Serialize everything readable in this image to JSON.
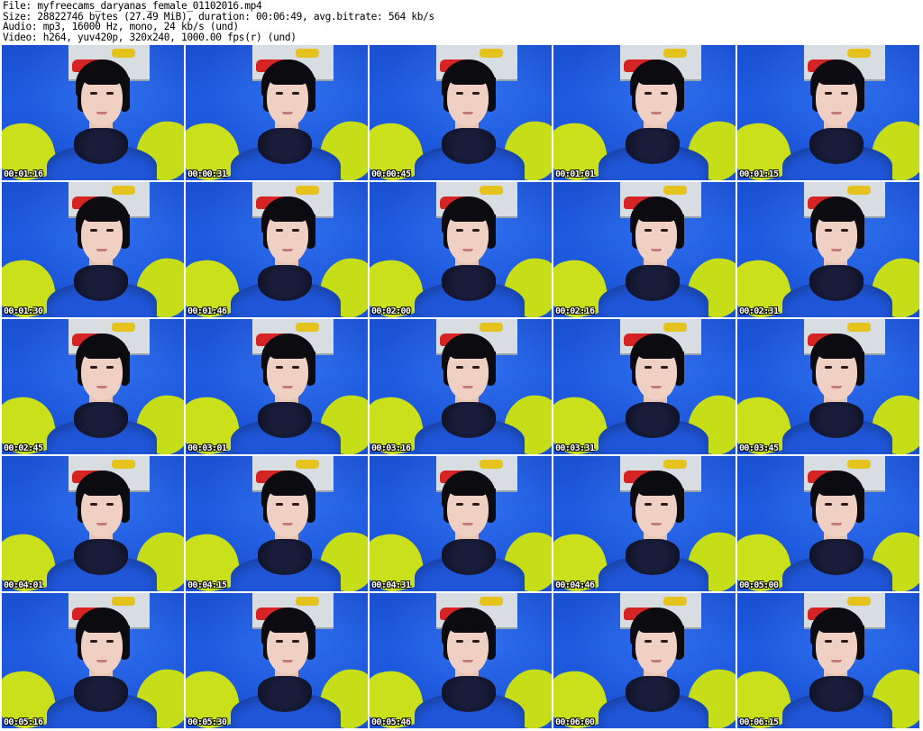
{
  "header": {
    "file_line": "File: myfreecams_daryanas_female_01102016.mp4",
    "size_line": "Size: 28822746 bytes (27.49 MiB), duration: 00:06:49, avg.bitrate: 564 kb/s",
    "audio_line": "Audio: mp3, 16000 Hz, mono, 24 kb/s (und)",
    "video_line": "Video: h264, yuv420p, 320x240, 1000.00 fps(r) (und)"
  },
  "thumbnails": [
    {
      "timestamp": "00:01:16"
    },
    {
      "timestamp": "00:00:31"
    },
    {
      "timestamp": "00:00:45"
    },
    {
      "timestamp": "00:01:01"
    },
    {
      "timestamp": "00:01:15"
    },
    {
      "timestamp": "00:01:30"
    },
    {
      "timestamp": "00:01:46"
    },
    {
      "timestamp": "00:02:00"
    },
    {
      "timestamp": "00:02:16"
    },
    {
      "timestamp": "00:02:31"
    },
    {
      "timestamp": "00:02:45"
    },
    {
      "timestamp": "00:03:01"
    },
    {
      "timestamp": "00:03:16"
    },
    {
      "timestamp": "00:03:31"
    },
    {
      "timestamp": "00:03:45"
    },
    {
      "timestamp": "00:04:01"
    },
    {
      "timestamp": "00:04:15"
    },
    {
      "timestamp": "00:04:31"
    },
    {
      "timestamp": "00:04:46"
    },
    {
      "timestamp": "00:05:00"
    },
    {
      "timestamp": "00:05:16"
    },
    {
      "timestamp": "00:05:30"
    },
    {
      "timestamp": "00:05:46"
    },
    {
      "timestamp": "00:06:00"
    },
    {
      "timestamp": "00:06:15"
    }
  ],
  "colors": {
    "wall": "#1e5ae0",
    "pillow": "#c9e01a",
    "top": "#1f56d8",
    "hair": "#0c0b10",
    "timestamp_text": "#ffffff"
  }
}
